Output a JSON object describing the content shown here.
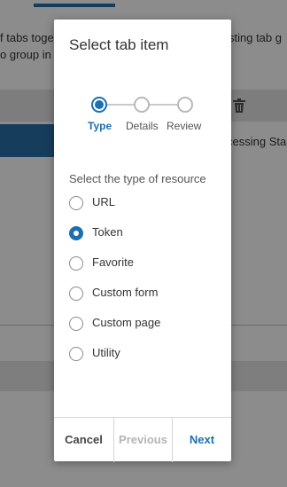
{
  "background": {
    "text_left_1": "f tabs toge",
    "text_left_2": "o group in",
    "text_right_1": "sting tab g",
    "text_right_2": "cessing Sta"
  },
  "modal": {
    "title": "Select tab item",
    "steps": [
      {
        "label": "Type",
        "active": true
      },
      {
        "label": "Details",
        "active": false
      },
      {
        "label": "Review",
        "active": false
      }
    ],
    "section_label": "Select the type of resource",
    "options": [
      {
        "label": "URL",
        "checked": false
      },
      {
        "label": "Token",
        "checked": true
      },
      {
        "label": "Favorite",
        "checked": false
      },
      {
        "label": "Custom form",
        "checked": false
      },
      {
        "label": "Custom page",
        "checked": false
      },
      {
        "label": "Utility",
        "checked": false
      }
    ],
    "selected_option": "Token",
    "footer": {
      "cancel_label": "Cancel",
      "previous_label": "Previous",
      "previous_enabled": false,
      "next_label": "Next"
    }
  },
  "colors": {
    "accent": "#1d6fb0",
    "disabled_text": "#b5b5b5",
    "overlay": "rgba(0,0,0,0.45)"
  },
  "icons": {
    "trash": "trash-icon"
  }
}
